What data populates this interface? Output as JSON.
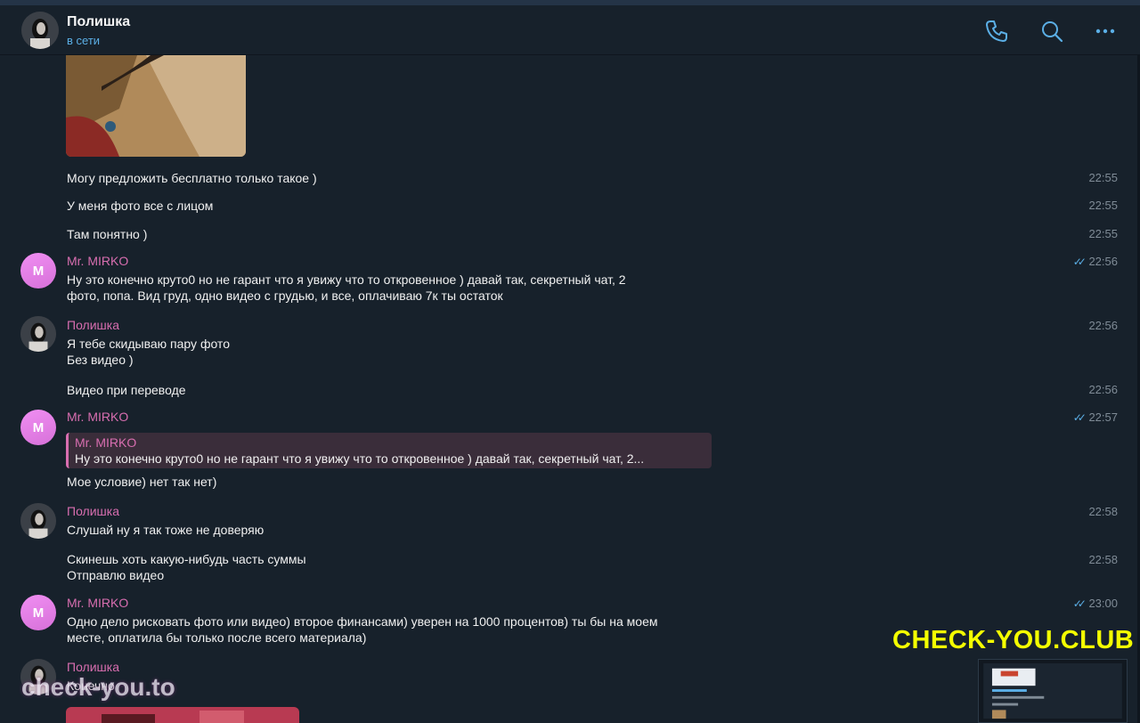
{
  "header": {
    "title": "Полишка",
    "status": "в сети"
  },
  "icons": {
    "call": "phone-icon",
    "search": "search-icon",
    "more": "more-icon"
  },
  "colors": {
    "background": "#17212b",
    "accent": "#5bafe6",
    "sender": "#d86eb0",
    "watermark": "#f4ff00"
  },
  "messages": [
    {
      "text": "Могу предложить бесплатно только такое )",
      "time": "22:55"
    },
    {
      "text": "У меня фото все с лицом",
      "time": "22:55"
    },
    {
      "text": "Там понятно )",
      "time": "22:55"
    },
    {
      "sender": "Mr. MIRKO",
      "avatar_letter": "M",
      "line1": "Ну это конечно круто0 но не гарант что я увижу что то откровенное ) давай так, секретный чат, 2",
      "line2": "фото, попа. Вид груд,  одно видео с грудью,  и все, оплачиваю 7к ты остаток",
      "time": "22:56"
    },
    {
      "sender": "Полишка",
      "line1": "Я тебе скидываю пару фото",
      "line2": "Без видео )",
      "time": "22:56"
    },
    {
      "text": "Видео при переводе",
      "time": "22:56"
    },
    {
      "sender": "Mr. MIRKO",
      "avatar_letter": "M",
      "reply_name": "Mr. MIRKO",
      "reply_text": "Ну это конечно круто0 но не гарант что я увижу что то откровенное ) давай так, секретный чат, 2...",
      "text": "Мое условие) нет так нет)",
      "time": "22:57"
    },
    {
      "sender": "Полишка",
      "text": "Слушай ну я так тоже не доверяю",
      "time": "22:58"
    },
    {
      "line1": "Скинешь хоть какую-нибудь часть суммы",
      "line2": "Отправлю видео",
      "time": "22:58"
    },
    {
      "sender": "Mr. MIRKO",
      "avatar_letter": "M",
      "line1": "Одно дело рисковать фото или видео) второе финансами) уверен на 1000 процентов) ты бы на моем",
      "line2": "месте, оплатила бы только после всего материала)",
      "time": "23:00"
    },
    {
      "sender": "Полишка",
      "text": "Конечно"
    }
  ],
  "watermarks": {
    "big": "CHECK-YOU.CLUB",
    "small": "check-you.to"
  }
}
